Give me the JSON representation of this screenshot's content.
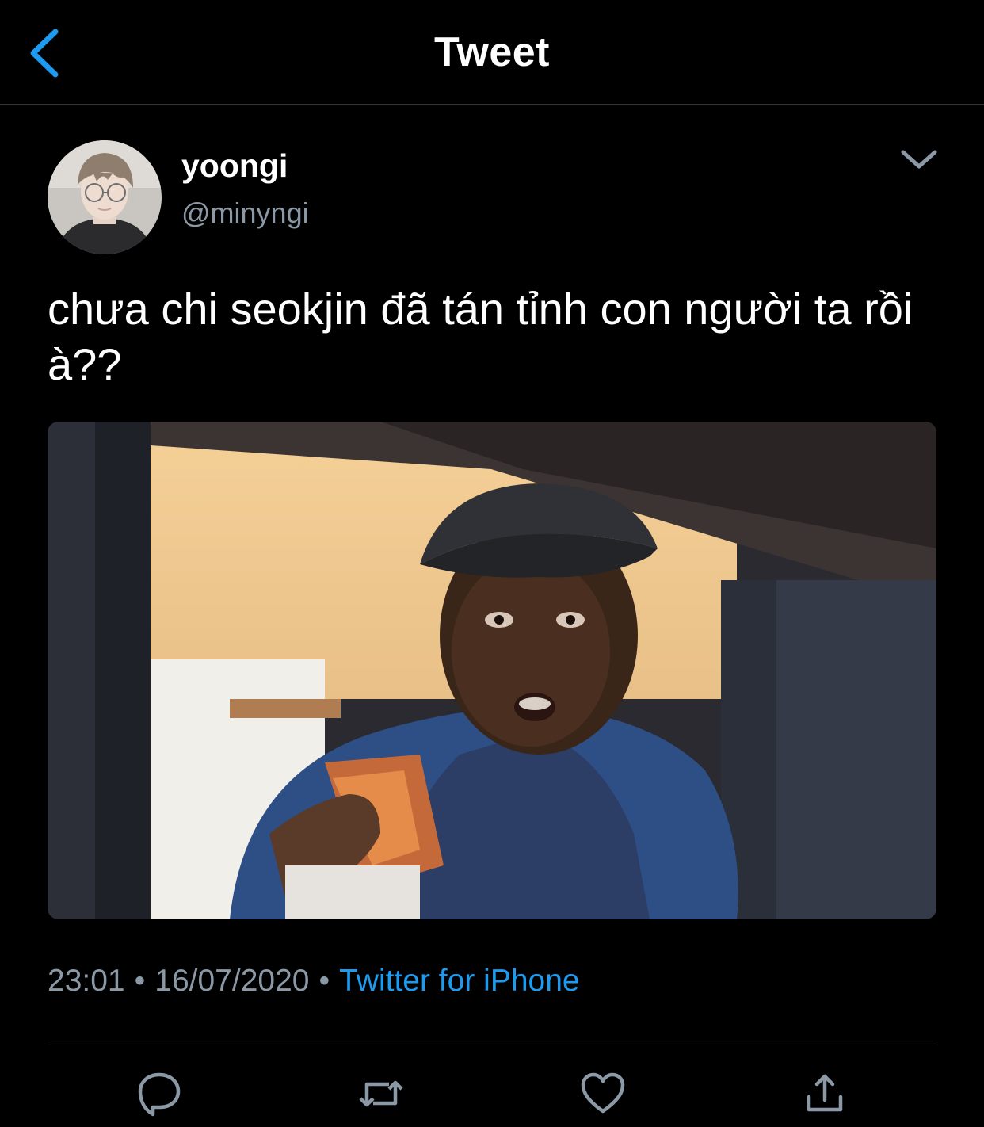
{
  "header": {
    "title": "Tweet",
    "back_icon": "chevron-left-icon",
    "accent_color": "#1d9bf0"
  },
  "tweet": {
    "author": {
      "display_name": "yoongi",
      "handle": "@minyngi"
    },
    "text": "chưa chi seokjin đã tán tỉnh con người ta rồi à??",
    "time": "23:01",
    "date": "16/07/2020",
    "separator": "•",
    "source": "Twitter for iPhone"
  },
  "actions": [
    "reply-icon",
    "retweet-icon",
    "like-icon",
    "share-icon"
  ]
}
